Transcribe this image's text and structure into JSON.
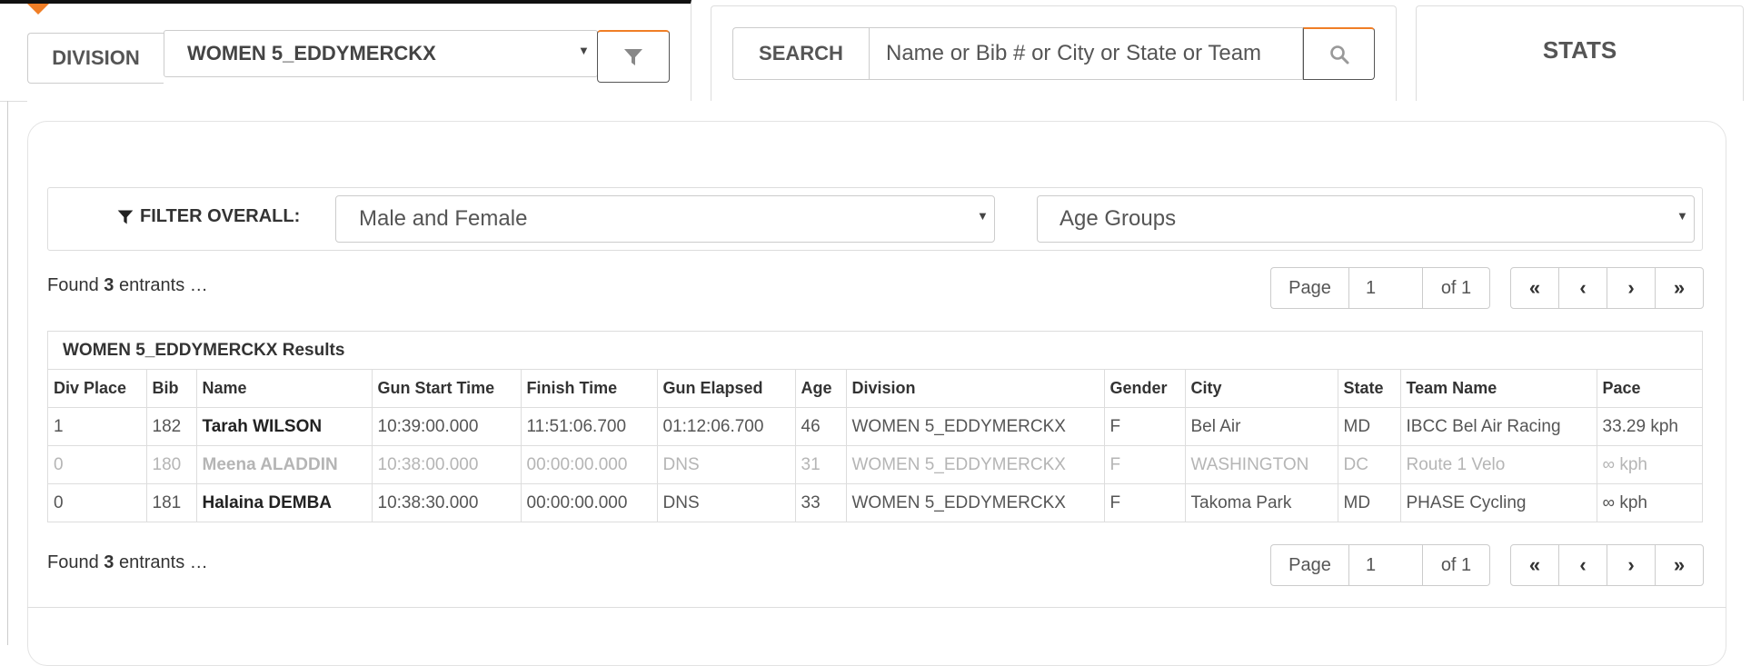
{
  "division": {
    "label": "DIVISION",
    "selected": "WOMEN 5_EDDYMERCKX"
  },
  "search": {
    "label": "SEARCH",
    "placeholder": "Name or Bib # or City or State or Team"
  },
  "stats": {
    "label": "STATS"
  },
  "filter": {
    "label": "FILTER OVERALL:",
    "gender_selected": "Male and Female",
    "age_selected": "Age Groups"
  },
  "found": {
    "prefix": "Found",
    "count": "3",
    "suffix": "entrants …"
  },
  "pager": {
    "page_label": "Page",
    "page_value": "1",
    "of_label": "of 1"
  },
  "results": {
    "title": "WOMEN 5_EDDYMERCKX Results",
    "columns": [
      "Div Place",
      "Bib",
      "Name",
      "Gun Start Time",
      "Finish Time",
      "Gun Elapsed",
      "Age",
      "Division",
      "Gender",
      "City",
      "State",
      "Team Name",
      "Pace"
    ],
    "rows": [
      {
        "place": "1",
        "bib": "182",
        "name": "Tarah WILSON",
        "start": "10:39:00.000",
        "finish": "11:51:06.700",
        "elapsed": "01:12:06.700",
        "age": "46",
        "division": "WOMEN 5_EDDYMERCKX",
        "gender": "F",
        "city": "Bel Air",
        "state": "MD",
        "team": "IBCC Bel Air Racing",
        "pace": "33.29 kph"
      },
      {
        "place": "0",
        "bib": "180",
        "name": "Meena ALADDIN",
        "start": "10:38:00.000",
        "finish": "00:00:00.000",
        "elapsed": "DNS",
        "age": "31",
        "division": "WOMEN 5_EDDYMERCKX",
        "gender": "F",
        "city": "WASHINGTON",
        "state": "DC",
        "team": "Route 1 Velo",
        "pace": "∞ kph"
      },
      {
        "place": "0",
        "bib": "181",
        "name": "Halaina DEMBA",
        "start": "10:38:30.000",
        "finish": "00:00:00.000",
        "elapsed": "DNS",
        "age": "33",
        "division": "WOMEN 5_EDDYMERCKX",
        "gender": "F",
        "city": "Takoma Park",
        "state": "MD",
        "team": "PHASE Cycling",
        "pace": "∞ kph"
      }
    ]
  },
  "colors": {
    "accent": "#f07e26",
    "border": "#dddddd",
    "dns_text": "#b5b5b5"
  }
}
